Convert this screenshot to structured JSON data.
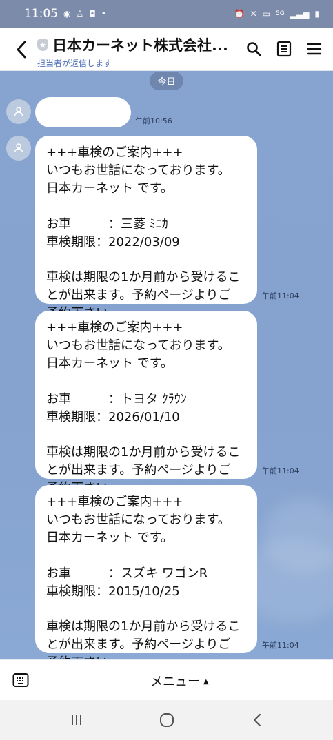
{
  "status_bar": {
    "time": "11:05",
    "left_icons": [
      "line-icon",
      "shield-icon",
      "check-shield-icon",
      "dot-icon"
    ],
    "right_icons": [
      "alarm-icon",
      "mute-icon",
      "volte-icon",
      "5g-icon",
      "signal-icon",
      "battery-icon"
    ],
    "network_text": "5G"
  },
  "header": {
    "title": "日本カーネット株式会社...",
    "subtitle": "担当者が返信します"
  },
  "chat": {
    "date_label": "今日",
    "messages": [
      {
        "text": "",
        "time": "午前10:56"
      },
      {
        "text": "+++車検のご案内+++\nいつもお世話になっております。\n日本カーネット です。\n\nお車　　　：三菱 ﾐﾆｶ\n車検期限：2022/03/09\n\n車検は期限の1か月前から受けるこ\nとが出来ます。予約ページよりご\n予約下さい。",
        "time": "午前11:04"
      },
      {
        "text": "+++車検のご案内+++\nいつもお世話になっております。\n日本カーネット です。\n\nお車　　　：トヨタ ｸﾗｳﾝ\n車検期限：2026/01/10\n\n車検は期限の1か月前から受けるこ\nとが出来ます。予約ページよりご\n予約下さい。",
        "time": "午前11:04"
      },
      {
        "text": "+++車検のご案内+++\nいつもお世話になっております。\n日本カーネット です。\n\nお車　　　：スズキ ワゴンR\n車検期限：2015/10/25\n\n車検は期限の1か月前から受けるこ\nとが出来ます。予約ページよりご\n予約下さい。",
        "time": "午前11:04"
      }
    ]
  },
  "footer": {
    "menu_label": "メニュー",
    "menu_caret": "▲"
  },
  "system_nav": {
    "recent": "|||",
    "home": "○",
    "back": "<"
  },
  "colors": {
    "chat_background": "#87A3CF",
    "header_background": "#FFFFFF",
    "accent_blue": "#4F70B7",
    "bubble_background": "#FFFFFF"
  }
}
